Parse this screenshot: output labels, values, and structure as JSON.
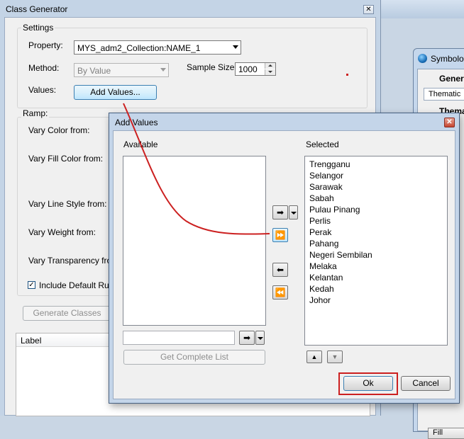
{
  "class_generator": {
    "title": "Class Generator",
    "close_glyph": "✕",
    "settings_label": "Settings",
    "property_label": "Property:",
    "property_value": "MYS_adm2_Collection:NAME_1",
    "method_label": "Method:",
    "method_value": "By Value",
    "sample_size_label": "Sample Size:",
    "sample_size_value": "1000",
    "values_label": "Values:",
    "add_values_button": "Add Values...",
    "ramp_label": "Ramp:",
    "vary_color": "Vary Color from:",
    "vary_fill_color": "Vary Fill Color from:",
    "vary_line_style": "Vary Line Style from:",
    "vary_weight": "Vary Weight from:",
    "vary_transparency": "Vary Transparency from",
    "include_default_rule": "Include Default Rule",
    "include_default_checked": "✓",
    "generate_classes_button": "Generate Classes",
    "label_column": "Label"
  },
  "symbology": {
    "title": "Symbolo",
    "general_tab": "Genera",
    "thematic_value": "Thematic",
    "thematic_header": "Thema",
    "fill_button": "Fill"
  },
  "add_values": {
    "title": "Add Values",
    "close_glyph": "✕",
    "available_label": "Available",
    "selected_label": "Selected",
    "available_items": [],
    "selected_items": [
      "Trengganu",
      "Selangor",
      "Sarawak",
      "Sabah",
      "Pulau Pinang",
      "Perlis",
      "Perak",
      "Pahang",
      "Negeri Sembilan",
      "Melaka",
      "Kelantan",
      "Kedah",
      "Johor"
    ],
    "filter_input_value": "",
    "get_complete_list_button": "Get Complete List",
    "ok_button": "Ok",
    "cancel_button": "Cancel",
    "glyphs": {
      "move_right": "➡",
      "move_all_right": "⏩",
      "move_left": "⬅",
      "move_all_left": "⏪",
      "up": "▲",
      "down": "▼"
    }
  },
  "colors": {
    "annotation_red": "#cc2020",
    "window_frame": "#c4d4e6",
    "dialog_body": "#f0f0f0"
  }
}
